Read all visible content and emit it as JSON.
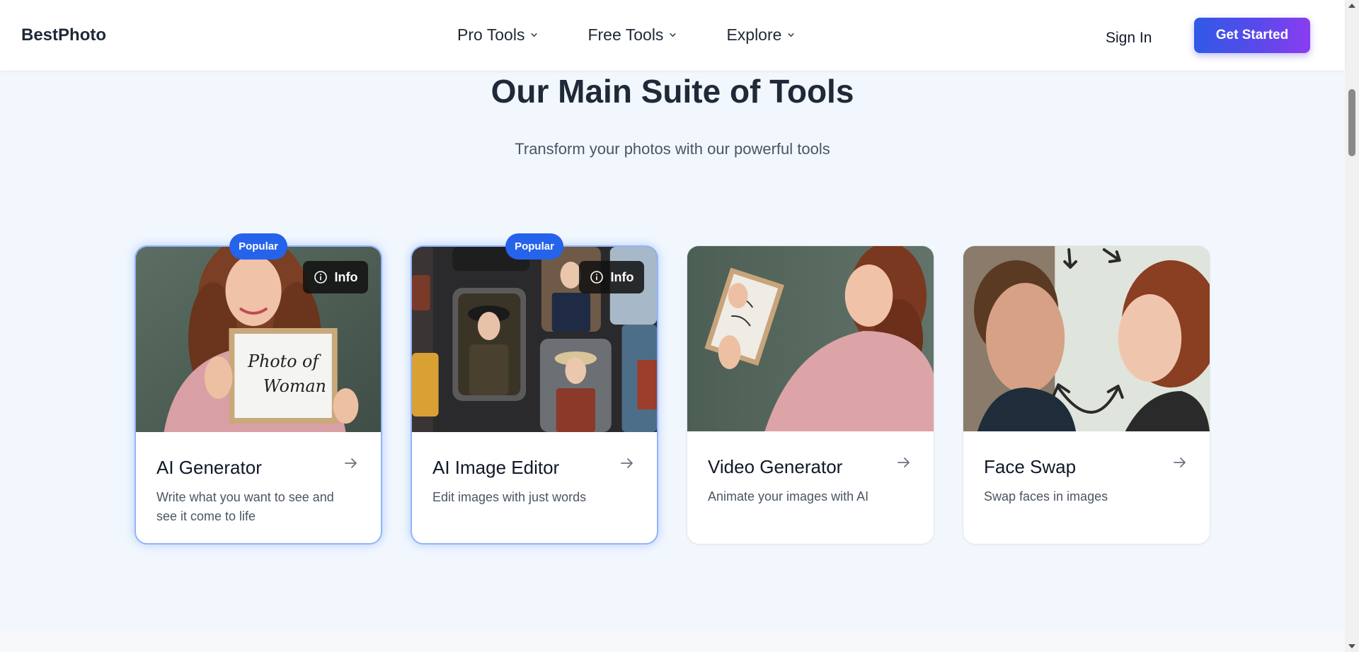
{
  "header": {
    "logo": "BestPhoto",
    "nav": [
      {
        "label": "Pro Tools"
      },
      {
        "label": "Free Tools"
      },
      {
        "label": "Explore"
      }
    ],
    "sign_in": "Sign In",
    "get_started": "Get Started"
  },
  "hero": {
    "title": "Our Main Suite of Tools",
    "subtitle": "Transform your photos with our powerful tools"
  },
  "cards": [
    {
      "title": "AI Generator",
      "description": "Write what you want to see and see it come to life",
      "badge": "Popular",
      "info": "Info",
      "sign_text_1": "Photo of",
      "sign_text_2": "Woman"
    },
    {
      "title": "AI Image Editor",
      "description": "Edit images with just words",
      "badge": "Popular",
      "info": "Info"
    },
    {
      "title": "Video Generator",
      "description": "Animate your images with AI"
    },
    {
      "title": "Face Swap",
      "description": "Swap faces in images"
    }
  ],
  "colors": {
    "accent_blue": "#2563eb",
    "gradient_start": "#2f5ae6",
    "gradient_end": "#8a3df0",
    "page_bg": "#f2f7fe"
  },
  "icons": {
    "nav_chevron": "chevron-down-icon",
    "info": "info-circle-icon",
    "card_arrow": "arrow-right-icon"
  }
}
